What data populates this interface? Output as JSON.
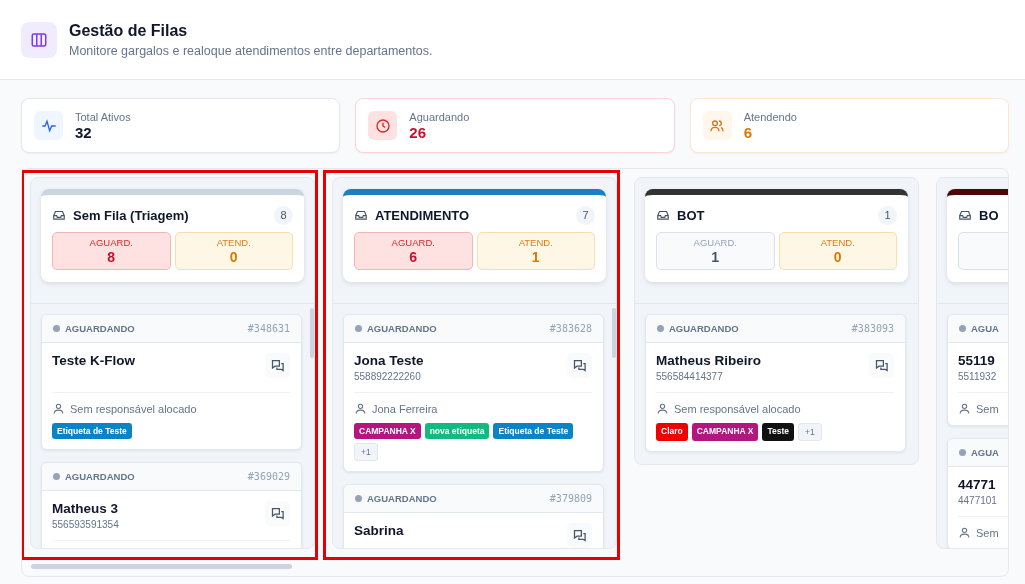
{
  "header": {
    "title": "Gestão de Filas",
    "subtitle": "Monitore gargalos e realoque atendimentos entre departamentos."
  },
  "summary": [
    {
      "kind": "total",
      "label": "Total Ativos",
      "value": "32"
    },
    {
      "kind": "waiting",
      "label": "Aguardando",
      "value": "26"
    },
    {
      "kind": "serving",
      "label": "Atendendo",
      "value": "6"
    }
  ],
  "columns": [
    {
      "title": "Sem Fila (Triagem)",
      "count": "8",
      "color": "#cbd5e1",
      "highlighted": true,
      "stats": [
        {
          "kind": "waiting",
          "label": "AGUARD.",
          "value": "8",
          "alert": true
        },
        {
          "kind": "serving",
          "label": "ATEND.",
          "value": "0",
          "alert": true
        }
      ],
      "cards": [
        {
          "status": "AGUARDANDO",
          "id": "#348631",
          "name": "Teste K-Flow",
          "chat_button": true,
          "assignee": "Sem responsável alocado",
          "tags": [
            {
              "label": "Etiqueta de Teste",
              "color": "#0b84c6"
            }
          ]
        },
        {
          "status": "AGUARDANDO",
          "id": "#369029",
          "name": "Matheus 3",
          "chat_button": true,
          "phone": "556593591354"
        }
      ]
    },
    {
      "title": "ATENDIMENTO",
      "count": "7",
      "color": "#1b7fc0",
      "highlighted": true,
      "stats": [
        {
          "kind": "waiting",
          "label": "AGUARD.",
          "value": "6",
          "alert": true
        },
        {
          "kind": "serving",
          "label": "ATEND.",
          "value": "1",
          "alert": true
        }
      ],
      "cards": [
        {
          "status": "AGUARDANDO",
          "id": "#383628",
          "name": "Jona Teste",
          "chat_button": true,
          "phone": "558892222260",
          "assignee": "Jona Ferreira",
          "tags": [
            {
              "label": "CAMPANHA X",
              "color": "#b5157f"
            },
            {
              "label": "nova etiqueta",
              "color": "#12b981"
            },
            {
              "label": "Etiqueta de Teste",
              "color": "#0b84c6"
            },
            {
              "label": "+1",
              "kind": "more"
            }
          ]
        },
        {
          "status": "AGUARDANDO",
          "id": "#379809",
          "name": "Sabrina",
          "chat_button": true
        }
      ]
    },
    {
      "title": "BOT",
      "count": "1",
      "color": "#333333",
      "highlighted": false,
      "stats": [
        {
          "kind": "waiting",
          "label": "AGUARD.",
          "value": "1",
          "alert": false
        },
        {
          "kind": "serving",
          "label": "ATEND.",
          "value": "0",
          "alert": true
        }
      ],
      "cards": [
        {
          "status": "AGUARDANDO",
          "id": "#383093",
          "name": "Matheus Ribeiro",
          "chat_button": true,
          "phone": "556584414377",
          "assignee": "Sem responsável alocado",
          "tags": [
            {
              "label": "Claro",
              "color": "#ee0000"
            },
            {
              "label": "CAMPANHA X",
              "color": "#b5157f"
            },
            {
              "label": "Teste",
              "color": "#111111"
            },
            {
              "label": "+1",
              "kind": "more"
            }
          ]
        }
      ]
    },
    {
      "title": "BO",
      "color": "#4a0808",
      "highlighted": false,
      "stats": [
        {
          "kind": "waiting",
          "alert": false
        }
      ],
      "cards": [
        {
          "status": "AGUA",
          "name": "55119",
          "phone": "5511932",
          "assignee": "Sem"
        },
        {
          "status": "AGUA",
          "name": "44771",
          "phone": "4477101",
          "assignee": "Sem"
        }
      ]
    }
  ]
}
